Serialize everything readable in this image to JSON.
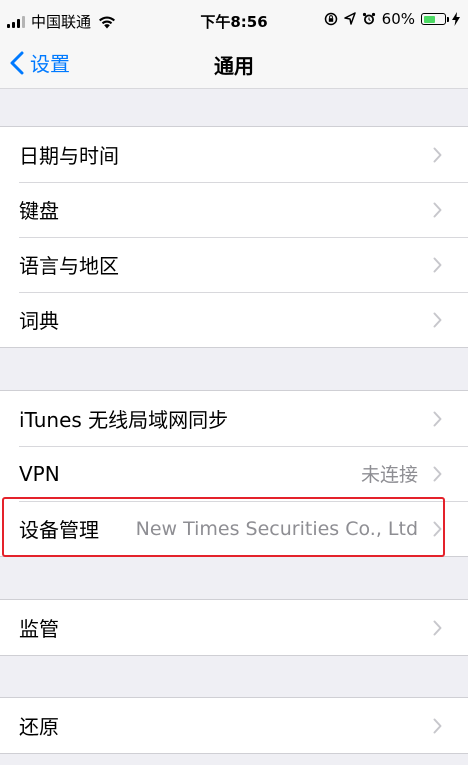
{
  "status_bar": {
    "carrier": "中国联通",
    "time": "下午8:56",
    "battery_percent": "60%",
    "battery_level": 0.6,
    "icons": [
      "signal-icon",
      "wifi-icon",
      "rotation-lock-icon",
      "location-icon",
      "alarm-icon",
      "battery-icon",
      "charging-icon"
    ]
  },
  "nav": {
    "back_label": "设置",
    "title": "通用"
  },
  "groups": [
    {
      "rows": [
        {
          "label": "日期与时间",
          "value": ""
        },
        {
          "label": "键盘",
          "value": ""
        },
        {
          "label": "语言与地区",
          "value": ""
        },
        {
          "label": "词典",
          "value": ""
        }
      ]
    },
    {
      "rows": [
        {
          "label": "iTunes 无线局域网同步",
          "value": ""
        },
        {
          "label": "VPN",
          "value": "未连接"
        },
        {
          "label": "设备管理",
          "value": "New Times Securities Co., Ltd"
        }
      ]
    },
    {
      "rows": [
        {
          "label": "监管",
          "value": ""
        }
      ]
    },
    {
      "rows": [
        {
          "label": "还原",
          "value": ""
        }
      ]
    }
  ],
  "colors": {
    "accent": "#007aff",
    "background": "#efeff4",
    "highlight": "#e4222b",
    "secondary_text": "#8e8e93",
    "battery_fill": "#4cd964"
  }
}
